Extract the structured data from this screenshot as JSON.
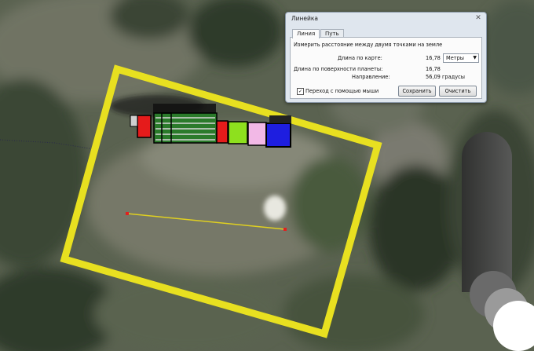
{
  "ruler": {
    "title": "Линейка",
    "tabs": [
      {
        "label": "Линия",
        "active": true
      },
      {
        "label": "Путь",
        "active": false
      }
    ],
    "description": "Измерить расстояние между двумя точками на земле",
    "map_length_label": "Длина по карте:",
    "map_length_value": "16,78",
    "unit_selected": "Метры",
    "surface_length_label": "Длина по поверхности планеты:",
    "surface_length_value": "16,78",
    "heading_label": "Направление:",
    "heading_value": "56,09 градусы",
    "mouse_nav_label": "Переход с помощью мыши",
    "mouse_nav_checked": true,
    "save_label": "Сохранить",
    "clear_label": "Очистить"
  },
  "colors": {
    "boundary": "#e8e020",
    "measure_line": "#e0d020",
    "measure_point": "#e02020",
    "blocks": [
      "#e51b1b",
      "#2a7a2a",
      "#e51b1b",
      "#8ee01e",
      "#f2b8e6",
      "#1e1ee0"
    ]
  },
  "icons": [
    "close-icon",
    "chevron-down-icon",
    "checkbox-icon",
    "navigation-control-icon"
  ]
}
